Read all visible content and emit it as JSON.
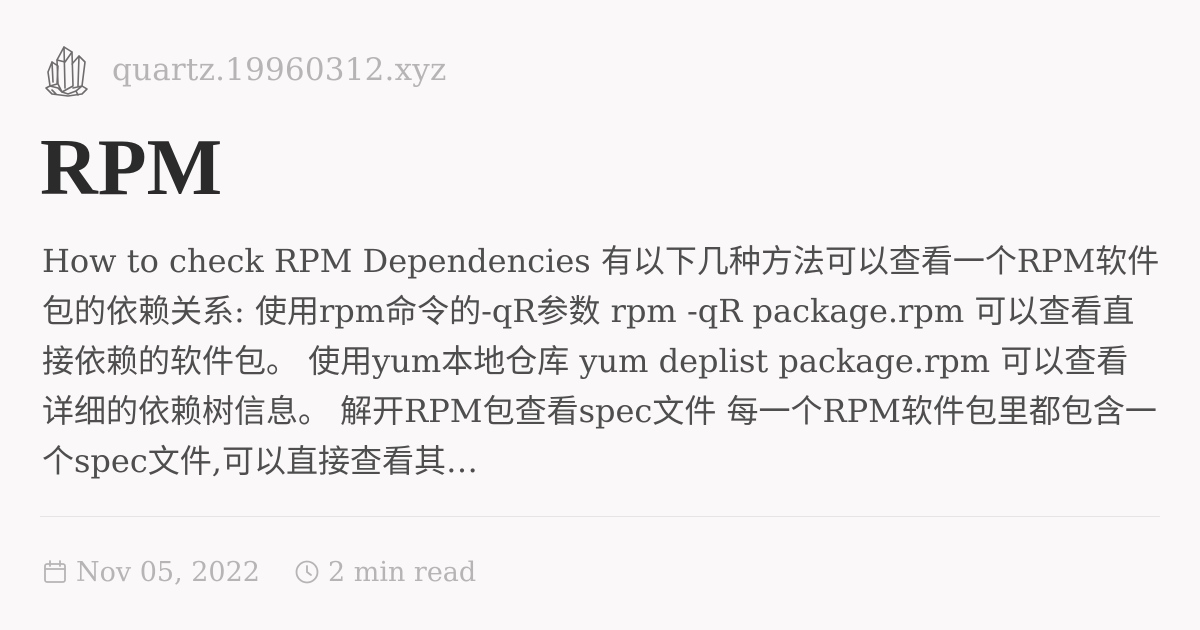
{
  "header": {
    "logo_icon": "crystal-cluster-icon",
    "site_name": "quartz.19960312.xyz"
  },
  "post": {
    "title": "RPM",
    "description": "How to check RPM Dependencies 有以下几种方法可以查看一个RPM软件包的依赖关系: 使用rpm命令的-qR参数 rpm -qR package.rpm 可以查看直接依赖的软件包。 使用yum本地仓库 yum deplist package.rpm 可以查看详细的依赖树信息。 解开RPM包查看spec文件 每一个RPM软件包里都包含一个spec文件,可以直接查看其…"
  },
  "meta": {
    "date_icon": "calendar-icon",
    "date": "Nov 05, 2022",
    "reading_time_icon": "clock-icon",
    "reading_time": "2 min read"
  },
  "colors": {
    "background": "#faf8f8",
    "title": "#2b2b2b",
    "body_text": "#4e4e4e",
    "muted_text": "#b7b4b6",
    "divider": "#e8e4e5"
  }
}
